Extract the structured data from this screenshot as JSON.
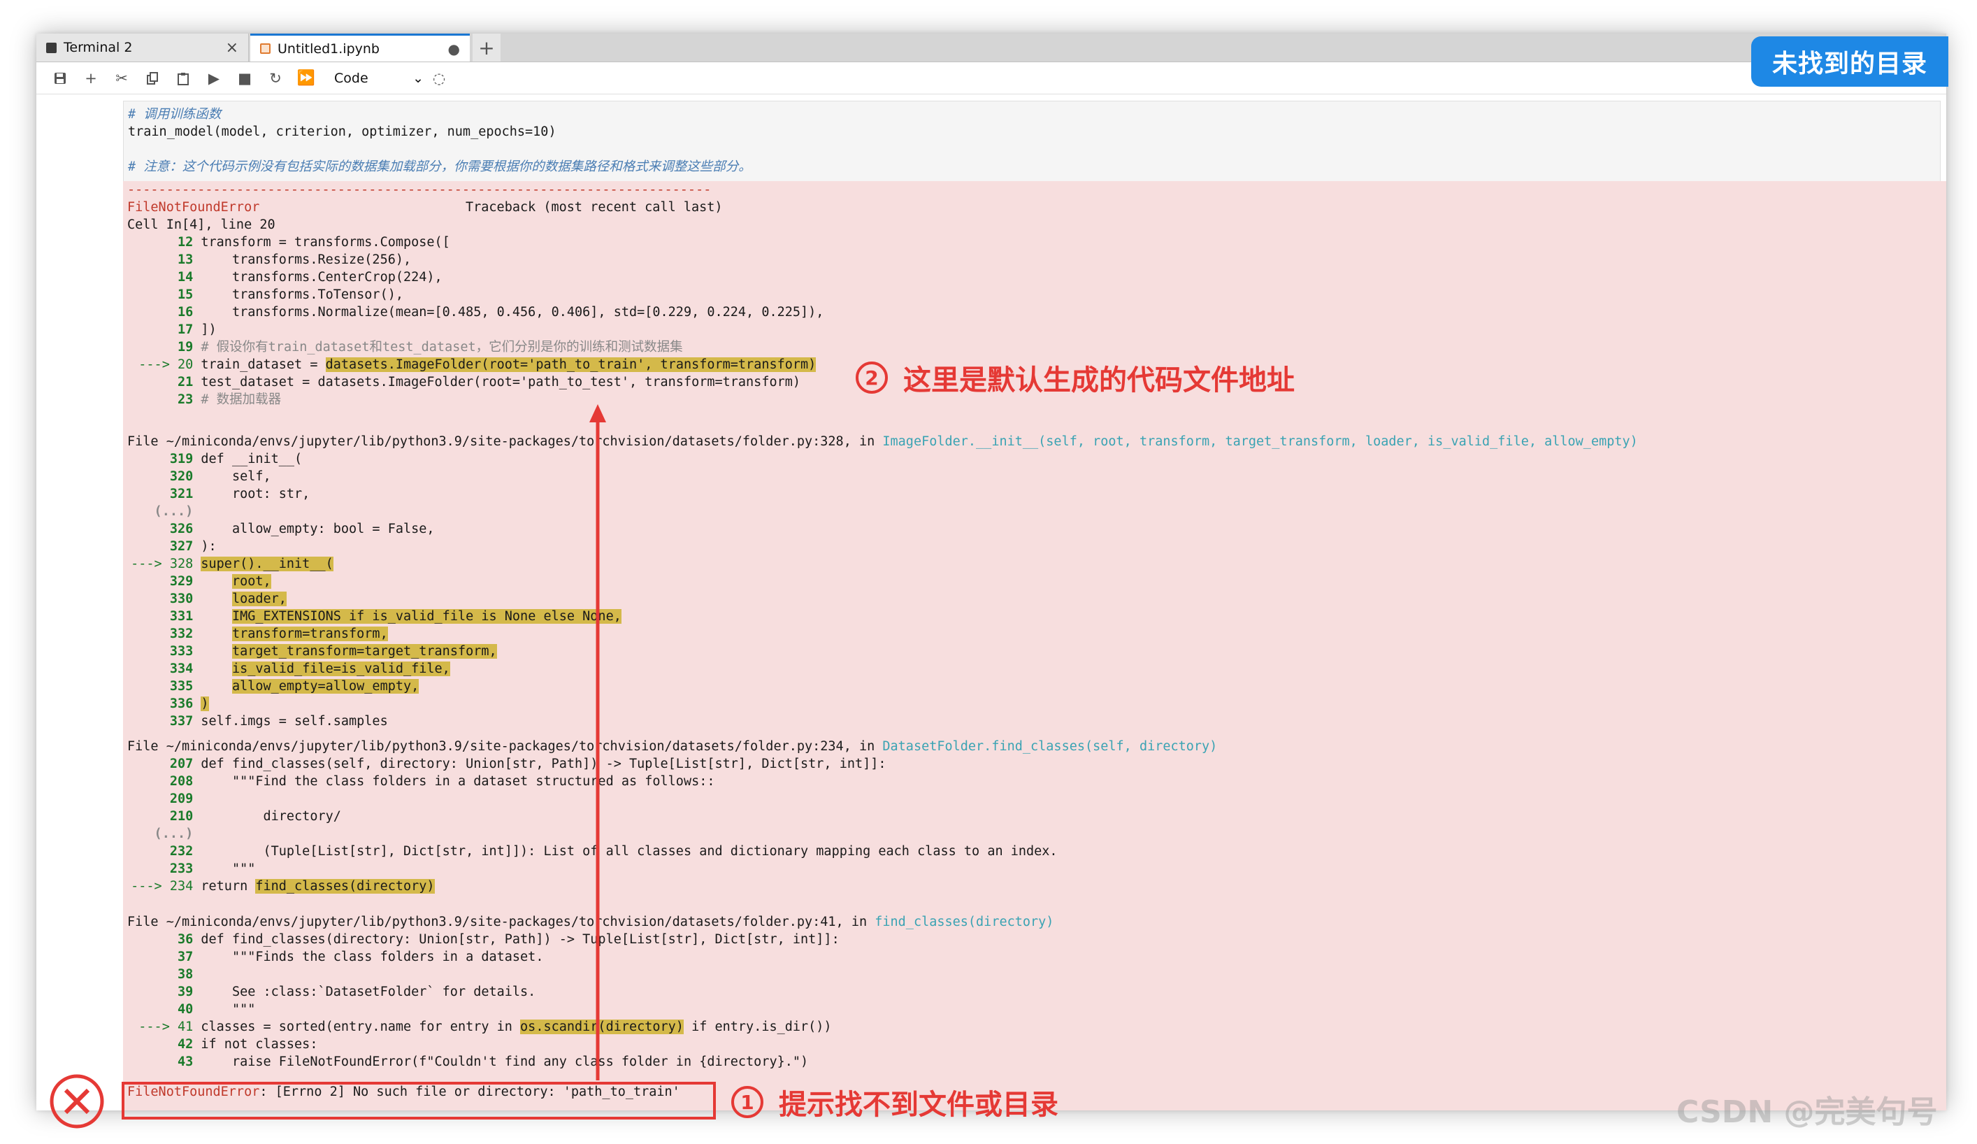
{
  "tabs": [
    {
      "label": "Terminal 2"
    },
    {
      "label": "Untitled1.ipynb"
    }
  ],
  "toolbar": {
    "cell_type": "Code",
    "icons": [
      "save-icon",
      "add-cell-icon",
      "cut-icon",
      "copy-icon",
      "paste-icon",
      "run-icon",
      "stop-icon",
      "restart-icon",
      "fast-forward-icon",
      "kernel-icon"
    ]
  },
  "code_cell": {
    "lines": [
      "# 调用训练函数",
      "train_model(model, criterion, optimizer, num_epochs=10)",
      "",
      "# 注意：这个代码示例没有包括实际的数据集加载部分，你需要根据你的数据集路径和格式来调整这些部分。"
    ]
  },
  "traceback": {
    "separator": "---------------------------------------------------------------------------",
    "error_name": "FileNotFoundError",
    "header_right": "Traceback (most recent call last)",
    "cell_ref": "Cell In[4], line 20",
    "block1": [
      {
        "num": "12",
        "code": "transform = transforms.Compose(["
      },
      {
        "num": "13",
        "code": "    transforms.Resize(256),"
      },
      {
        "num": "14",
        "code": "    transforms.CenterCrop(224),"
      },
      {
        "num": "15",
        "code": "    transforms.ToTensor(),"
      },
      {
        "num": "16",
        "code": "    transforms.Normalize(mean=[0.485, 0.456, 0.406], std=[0.229, 0.224, 0.225]),"
      },
      {
        "num": "17",
        "code": "])"
      },
      {
        "num": "19",
        "code": "# 假设你有train_dataset和test_dataset，它们分别是你的训练和测试数据集"
      },
      {
        "num": "20",
        "code_pre": "train_dataset = ",
        "code_hl": "datasets.ImageFolder(root='path_to_train', transform=transform)"
      },
      {
        "num": "21",
        "code": "test_dataset = datasets.ImageFolder(root='path_to_test', transform=transform)"
      },
      {
        "num": "23",
        "code": "# 数据加载器"
      }
    ],
    "file1_prefix": "File ~/miniconda/envs/jupyter/lib/python3.9/site-packages/torchvision/datasets/folder.py:328, in ",
    "file1_func": "ImageFolder.__init__(self, root, transform, target_transform, loader, is_valid_file, allow_empty)",
    "block2": [
      {
        "num": "319",
        "code": "def __init__("
      },
      {
        "num": "320",
        "code": "    self,"
      },
      {
        "num": "321",
        "code": "    root: str,"
      },
      {
        "num": "(...)",
        "code": ""
      },
      {
        "num": "326",
        "code": "    allow_empty: bool = False,"
      },
      {
        "num": "327",
        "code": "):"
      },
      {
        "num": "328",
        "code_hl": "super().__init__("
      },
      {
        "num": "329",
        "code_hl": "    root,"
      },
      {
        "num": "330",
        "code_hl": "    loader,"
      },
      {
        "num": "331",
        "code_hl": "    IMG_EXTENSIONS if is_valid_file is None else None,"
      },
      {
        "num": "332",
        "code_hl": "    transform=transform,"
      },
      {
        "num": "333",
        "code_hl": "    target_transform=target_transform,"
      },
      {
        "num": "334",
        "code_hl": "    is_valid_file=is_valid_file,"
      },
      {
        "num": "335",
        "code_hl": "    allow_empty=allow_empty,"
      },
      {
        "num": "336",
        "code_hl": ")"
      },
      {
        "num": "337",
        "code": "self.imgs = self.samples"
      }
    ],
    "file2_prefix": "File ~/miniconda/envs/jupyter/lib/python3.9/site-packages/torchvision/datasets/folder.py:234, in ",
    "file2_func": "DatasetFolder.find_classes(self, directory)",
    "block3": [
      {
        "num": "207",
        "code": "def find_classes(self, directory: Union[str, Path]) -> Tuple[List[str], Dict[str, int]]:"
      },
      {
        "num": "208",
        "code": "    \"\"\"Find the class folders in a dataset structured as follows::"
      },
      {
        "num": "209",
        "code": ""
      },
      {
        "num": "210",
        "code": "        directory/"
      },
      {
        "num": "(...)",
        "code": ""
      },
      {
        "num": "232",
        "code": "        (Tuple[List[str], Dict[str, int]]): List of all classes and dictionary mapping each class to an index."
      },
      {
        "num": "233",
        "code": "    \"\"\""
      },
      {
        "num": "234",
        "code_pre": "return ",
        "code_hl": "find_classes(directory)"
      }
    ],
    "file3_prefix": "File ~/miniconda/envs/jupyter/lib/python3.9/site-packages/torchvision/datasets/folder.py:41, in ",
    "file3_func": "find_classes(directory)",
    "block4": [
      {
        "num": "36",
        "code": "def find_classes(directory: Union[str, Path]) -> Tuple[List[str], Dict[str, int]]:"
      },
      {
        "num": "37",
        "code": "    \"\"\"Finds the class folders in a dataset."
      },
      {
        "num": "38",
        "code": ""
      },
      {
        "num": "39",
        "code": "    See :class:`DatasetFolder` for details."
      },
      {
        "num": "40",
        "code": "    \"\"\""
      },
      {
        "num": "41",
        "code_pre": "classes = sorted(entry.name for entry in ",
        "code_hl": "os.scandir(directory)",
        "code_post": " if entry.is_dir())"
      },
      {
        "num": "42",
        "code": "if not classes:"
      },
      {
        "num": "43",
        "code": "    raise FileNotFoundError(f\"Couldn't find any class folder in {directory}.\")"
      }
    ],
    "final_error_name": "FileNotFoundError",
    "final_error_msg": ": [Errno 2] No such file or directory: 'path_to_train'"
  },
  "annotations": {
    "badge": "未找到的目录",
    "num1": "1",
    "label1": "提示找不到文件或目录",
    "num2": "2",
    "label2": "这里是默认生成的代码文件地址"
  },
  "watermark": "CSDN @完美句号",
  "colors": {
    "accent": "#1e88e5",
    "annotation": "#e53935",
    "output_bg": "#f7dede",
    "highlight": "#d4b94a"
  }
}
